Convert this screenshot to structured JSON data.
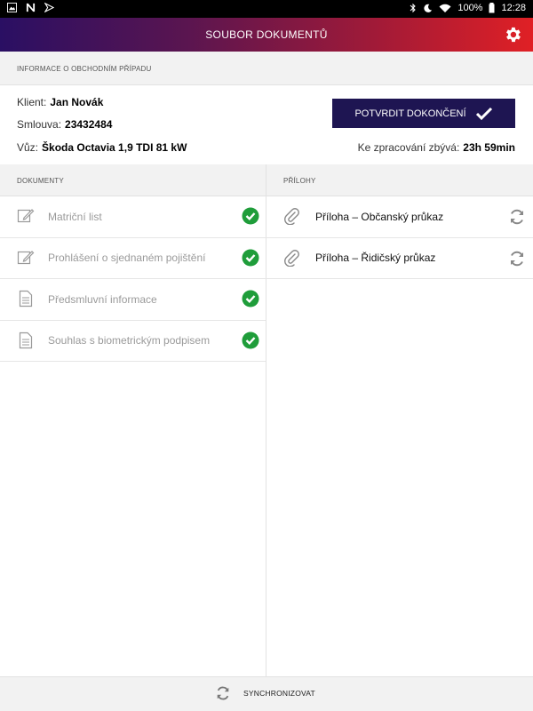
{
  "status_bar": {
    "left_icons": [
      "image-icon",
      "n-icon",
      "download-icon"
    ],
    "right_icons": [
      "bluetooth-icon",
      "moon-icon",
      "wifi-icon"
    ],
    "battery": "100%",
    "time": "12:28"
  },
  "app_bar": {
    "title": "SOUBOR DOKUMENTŮ",
    "settings_icon": "gear-icon"
  },
  "info_section": {
    "header": "INFORMACE O OBCHODNÍM PŘÍPADU",
    "client_label": "Klient:",
    "client_value": "Jan Novák",
    "contract_label": "Smlouva:",
    "contract_value": "23432484",
    "car_label": "Vůz:",
    "car_value": "Škoda Octavia 1,9 TDI 81 kW",
    "confirm_button": "POTVRDIT DOKONČENÍ",
    "remaining_label": "Ke zpracování zbývá:",
    "remaining_value": "23h 59min"
  },
  "documents": {
    "header": "DOKUMENTY",
    "items": [
      {
        "label": "Matriční list",
        "icon": "edit-icon",
        "status": "done"
      },
      {
        "label": "Prohlášení o sjednaném pojištění",
        "icon": "edit-icon",
        "status": "done"
      },
      {
        "label": "Předsmluvní informace",
        "icon": "document-icon",
        "status": "done"
      },
      {
        "label": "Souhlas s biometrickým podpisem",
        "icon": "document-icon",
        "status": "done"
      }
    ]
  },
  "attachments": {
    "header": "PŘÍLOHY",
    "items": [
      {
        "label": "Příloha – Občanský průkaz",
        "icon": "paperclip-icon"
      },
      {
        "label": "Příloha – Řidičský průkaz",
        "icon": "paperclip-icon"
      }
    ]
  },
  "footer": {
    "sync_label": "SYNCHRONIZOVAT"
  },
  "colors": {
    "confirm_button_bg": "#1e1552",
    "check_green": "#1f9d3a",
    "gradient_start": "#2a0f63",
    "gradient_end": "#e02025"
  }
}
